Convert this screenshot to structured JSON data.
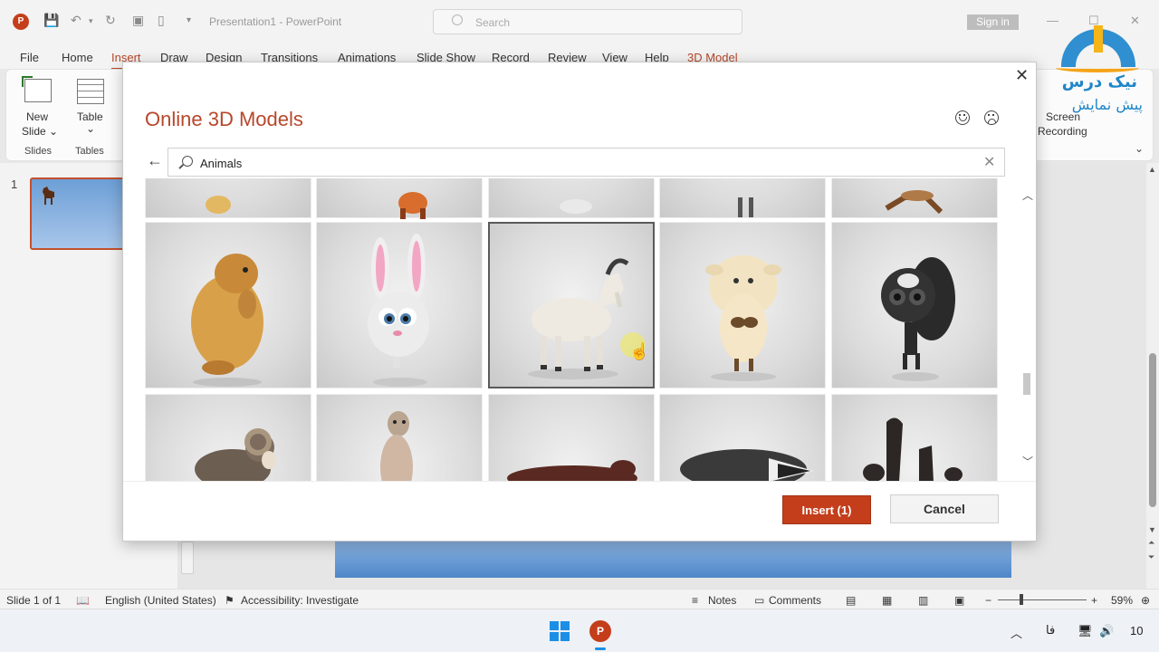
{
  "titlebar": {
    "app_icon_letter": "P",
    "doc_title": "Presentation1 - PowerPoint",
    "search_placeholder": "Search",
    "signin_label": "Sign in",
    "min_glyph": "—",
    "max_glyph": "☐",
    "close_glyph": "✕"
  },
  "logo": {
    "line1": "نیک درس",
    "line2": "پیش نمایش"
  },
  "ribbon": {
    "tabs": [
      "File",
      "Home",
      "Insert",
      "Draw",
      "Design",
      "Transitions",
      "Animations",
      "Slide Show",
      "Record",
      "Review",
      "View",
      "Help",
      "3D Model"
    ],
    "active_tab": "Insert",
    "new_slide_label": "New",
    "new_slide_label2": "Slide ⌄",
    "table_label": "Table",
    "table_chevron": "⌄",
    "group_slides": "Slides",
    "group_tables": "Tables",
    "screen_recording_1": "Screen",
    "screen_recording_2": "Recording",
    "collapse_glyph": "⌄"
  },
  "slides": {
    "number": "1"
  },
  "dialog": {
    "title": "Online 3D Models",
    "close_glyph": "✕",
    "back_glyph": "←",
    "search_value": "Animals",
    "clear_glyph": "✕",
    "scroll_up": "︿",
    "scroll_down": "﹀",
    "insert_label": "Insert (1)",
    "cancel_label": "Cancel",
    "selected_count": 1,
    "models_row1": [
      "fox-partial",
      "squirrel-partial",
      "white-partial",
      "cat-partial",
      "deer-partial"
    ],
    "models_row2": [
      "prairie-dog",
      "bunny",
      "goat",
      "sheep",
      "skunk"
    ],
    "models_row3": [
      "ram",
      "meerkat",
      "otter",
      "badger",
      "sea-lions"
    ],
    "selected_model": "goat"
  },
  "statusbar": {
    "slide_info": "Slide 1 of 1",
    "language": "English (United States)",
    "accessibility": "Accessibility: Investigate",
    "notes": "Notes",
    "comments": "Comments",
    "zoom_minus": "−",
    "zoom_plus": "+",
    "zoom_level": "59%"
  },
  "taskbar": {
    "powerpoint_letter": "P",
    "tray_chevron": "︿",
    "tray_lang": "فا",
    "time": "10"
  }
}
